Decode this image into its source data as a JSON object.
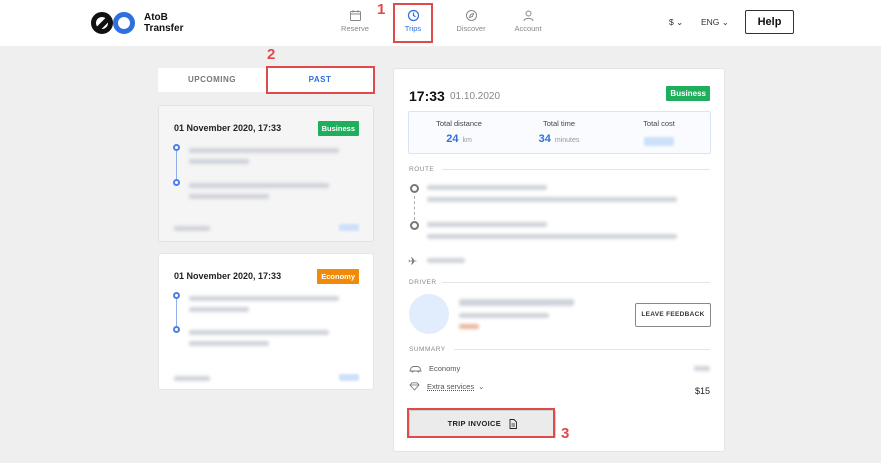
{
  "header": {
    "brand_line1": "AtoB",
    "brand_line2": "Transfer",
    "nav": [
      {
        "label": "Reserve",
        "icon": "calendar-icon"
      },
      {
        "label": "Trips",
        "icon": "clock-icon"
      },
      {
        "label": "Discover",
        "icon": "compass-icon"
      },
      {
        "label": "Account",
        "icon": "user-icon"
      }
    ],
    "currency": "$",
    "language": "ENG",
    "help_label": "Help"
  },
  "annotations": [
    "1",
    "2",
    "3"
  ],
  "tabs": {
    "upcoming": "UPCOMING",
    "past": "PAST"
  },
  "trips": [
    {
      "date": "01 November 2020, 17:33",
      "class": "Business"
    },
    {
      "date": "01 November 2020, 17:33",
      "class": "Economy"
    }
  ],
  "detail": {
    "time": "17:33",
    "date": "01.10.2020",
    "class": "Business",
    "stats": {
      "distance_label": "Total distance",
      "distance_value": "24",
      "distance_unit": "km",
      "time_label": "Total time",
      "time_value": "34",
      "time_unit": "minutes",
      "cost_label": "Total cost"
    },
    "route_title": "ROUTE",
    "driver_title": "DRIVER",
    "feedback_label": "LEAVE FEEDBACK",
    "summary_title": "SUMMARY",
    "summary_economy": "Economy",
    "summary_extra": "Extra services",
    "extra_price": "$15",
    "invoice_label": "TRIP INVOICE"
  },
  "colors": {
    "accent": "#2f6fe0",
    "business": "#1fae5b",
    "economy": "#f08a0b",
    "annotation": "#e04a4a"
  }
}
